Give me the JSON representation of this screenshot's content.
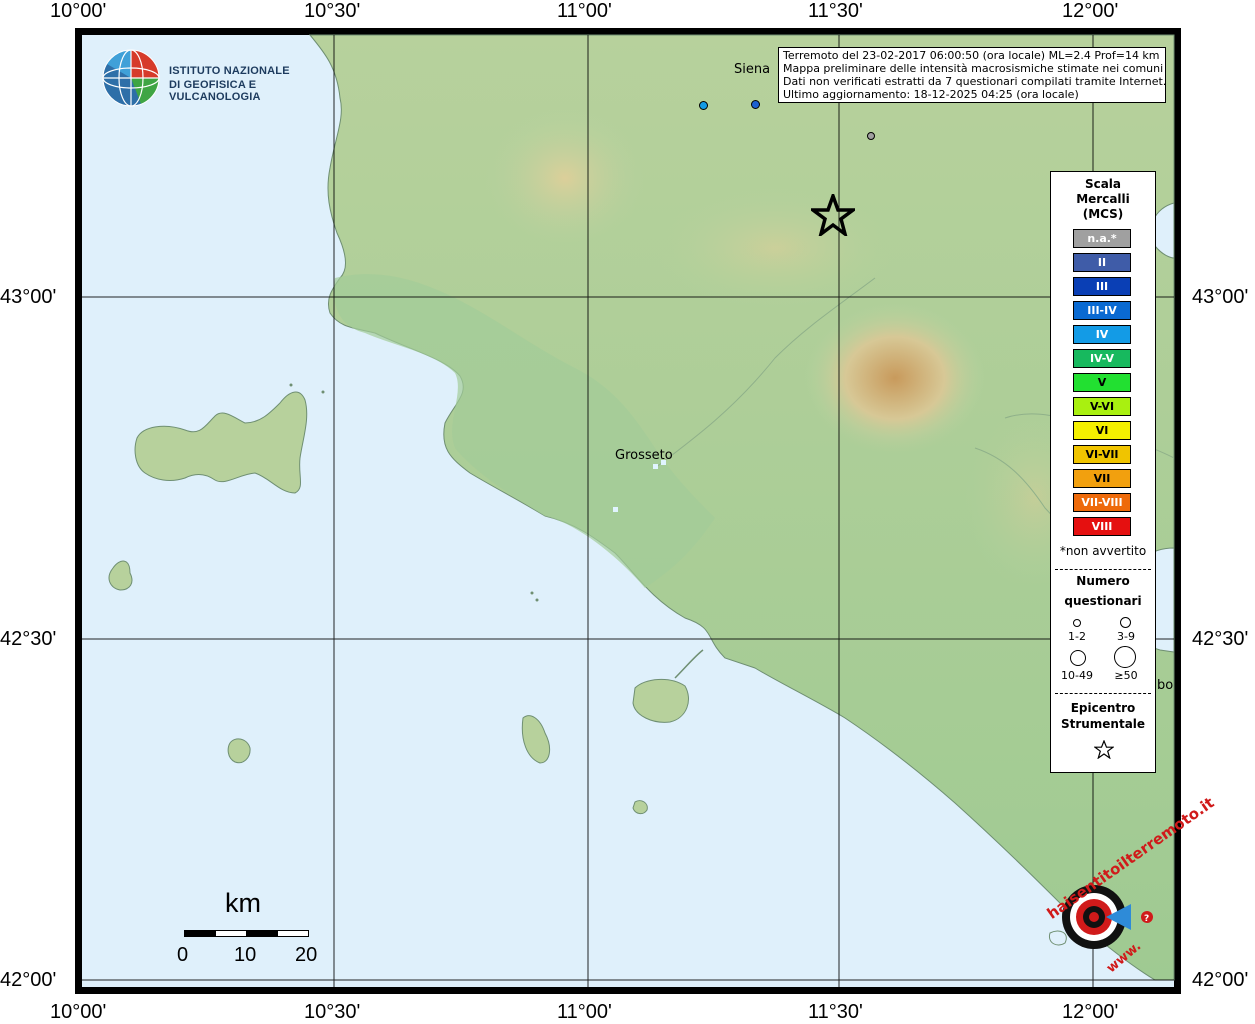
{
  "map": {
    "top_lon_labels": [
      "10°00'",
      "10°30'",
      "11°00'",
      "11°30'",
      "12°00'"
    ],
    "bottom_lon_labels": [
      "10°00'",
      "10°30'",
      "11°00'",
      "11°30'",
      "12°00'"
    ],
    "left_lat_labels": [
      "43°00'",
      "42°30'",
      "42°00'"
    ],
    "right_lat_labels": [
      "43°00'",
      "42°30'",
      "42°00'"
    ],
    "cities": {
      "siena": "Siena",
      "grosseto": "Grosseto",
      "partial_city": "bo"
    },
    "colors": {
      "sea": "#dff0fb",
      "land_low": "#9cc79a",
      "land_mid": "#b7d3a0",
      "land_high": "#cfc08f",
      "peak": "#b98a52"
    }
  },
  "info": {
    "line1": "Terremoto del 23-02-2017 06:00:50 (ora locale) ML=2.4 Prof=14 km",
    "line2": "Mappa preliminare delle intensità macrosismiche stimate nei comuni",
    "line3": "Dati non verificati estratti da 7 questionari compilati tramite Internet.",
    "line4": "Ultimo aggiornamento: 18-12-2025 04:25 (ora locale)"
  },
  "logo": {
    "line1": "ISTITUTO NAZIONALE",
    "line2": "DI GEOFISICA E VULCANOLOGIA",
    "corner_text": "haisentitoilterremoto.it",
    "corner_url": "www."
  },
  "legend": {
    "title_line1": "Scala",
    "title_line2": "Mercalli",
    "title_line3": "(MCS)",
    "levels": [
      {
        "label": "n.a.*",
        "color": "#a0a0a0"
      },
      {
        "label": "II",
        "color": "#3f5ca8"
      },
      {
        "label": "III",
        "color": "#0a3fb5"
      },
      {
        "label": "III-IV",
        "color": "#0a6ad2"
      },
      {
        "label": "IV",
        "color": "#139be6"
      },
      {
        "label": "IV-V",
        "color": "#17b95e"
      },
      {
        "label": "V",
        "color": "#22e031"
      },
      {
        "label": "V-VI",
        "color": "#a9f010"
      },
      {
        "label": "VI",
        "color": "#f4f000"
      },
      {
        "label": "VI-VII",
        "color": "#f0c400"
      },
      {
        "label": "VII",
        "color": "#f2a00e"
      },
      {
        "label": "VII-VIII",
        "color": "#ee6a0a"
      },
      {
        "label": "VIII",
        "color": "#e51010"
      }
    ],
    "not_felt_note": "*non avvertito",
    "questionnaires_line1": "Numero",
    "questionnaires_line2": "questionari",
    "sizes": [
      "1-2",
      "3-9",
      "10-49",
      "≥50"
    ],
    "epicenter_line1": "Epicentro",
    "epicenter_line2": "Strumentale"
  },
  "scale_bar": {
    "unit": "km",
    "labels": [
      "0",
      "10",
      "20"
    ]
  },
  "markers": [
    {
      "name": "Siena point",
      "intensity": "III-IV",
      "color": "#1c60d0"
    },
    {
      "name": "point IV",
      "intensity": "IV",
      "color": "#139be6"
    },
    {
      "name": "point n.a.",
      "intensity": "n.a.*",
      "color": "#a0a0a0"
    }
  ]
}
